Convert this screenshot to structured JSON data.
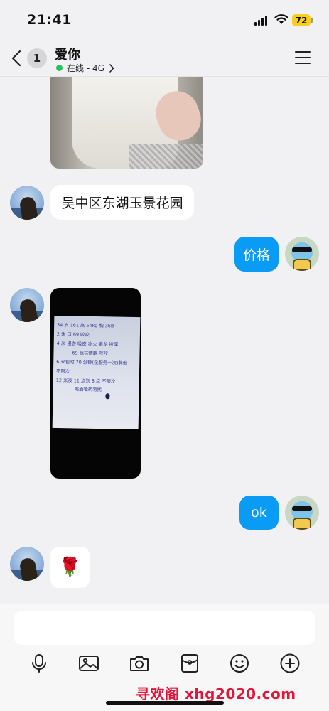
{
  "status_bar": {
    "time": "21:41",
    "battery": "72"
  },
  "header": {
    "unread_count": "1",
    "contact_name": "爱你",
    "status_text": "在线 - 4G"
  },
  "messages": {
    "location_text": "吴中区东湖玉景花园",
    "price_question": "价格",
    "ok_text": "ok",
    "rose_emoji": "🌹"
  },
  "menu_photo": {
    "lines": [
      "34 岁 161 高 54kg 胸 36B",
      "2 米 口  69  咬咬",
      "4 米  漫游  吸皮  冰火  毒龙  按摩",
      "69 丝袜情趣  咬咬",
      "6 米包时 70 分钟(全服务一次)其他",
      "不限次",
      "12 米夜 11 点到 8 点   不限次",
      "喝酒嗑药勿扰"
    ]
  },
  "input": {
    "placeholder": ""
  },
  "watermark": "寻欢阁 xhg2020.com"
}
